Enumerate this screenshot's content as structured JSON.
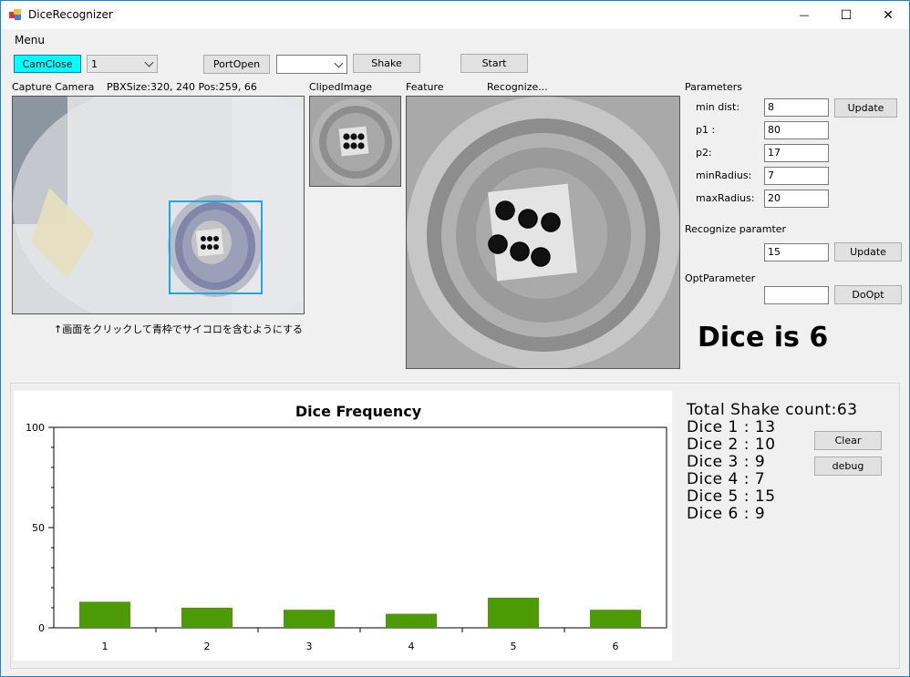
{
  "window": {
    "title": "DiceRecognizer",
    "minimize_glyph": "—",
    "maximize_glyph": "☐",
    "close_glyph": "✕"
  },
  "menu": {
    "label": "Menu"
  },
  "toolbar": {
    "camclose_label": "CamClose",
    "camera_select_value": "1",
    "portopen_label": "PortOpen",
    "port_select_value": "",
    "shake_label": "Shake",
    "start_label": "Start"
  },
  "capture": {
    "label": "Capture Camera",
    "info": "PBXSize:320, 240 Pos:259, 66",
    "hint": "↑画面をクリックして青枠でサイコロを含むようにする"
  },
  "clipped": {
    "label": "ClipedImage"
  },
  "feature": {
    "label": "Feature",
    "recognize_label": "Recognize..."
  },
  "parameters": {
    "header": "Parameters",
    "fields": [
      {
        "label": "min dist:",
        "value": "8"
      },
      {
        "label": "p1 :",
        "value": "80"
      },
      {
        "label": "p2:",
        "value": "17"
      },
      {
        "label": "minRadius:",
        "value": "7"
      },
      {
        "label": "maxRadius:",
        "value": "20"
      }
    ],
    "update_label": "Update"
  },
  "recognize_param": {
    "header": "Recognize paramter",
    "value": "15",
    "update_label": "Update"
  },
  "opt_param": {
    "header": "OptParameter",
    "value": "",
    "doopt_label": "DoOpt"
  },
  "result": {
    "text": "Dice is 6"
  },
  "stats": {
    "total": "Total Shake count:63",
    "lines": [
      "Dice 1 : 13",
      "Dice 2 : 10",
      "Dice 3 : 9",
      "Dice 4 : 7",
      "Dice 5 : 15",
      "Dice 6 : 9"
    ],
    "clear_label": "Clear",
    "debug_label": "debug"
  },
  "chart_data": {
    "type": "bar",
    "title": "Dice Frequency",
    "categories": [
      "1",
      "2",
      "3",
      "4",
      "5",
      "6"
    ],
    "values": [
      13,
      10,
      9,
      7,
      15,
      9
    ],
    "ylim": [
      0,
      100
    ],
    "yticks": [
      "0",
      "50",
      "100"
    ],
    "bar_color": "#4c9a06"
  },
  "colors": {
    "accent": "#00ffff",
    "selection_box": "#1ea7e1"
  }
}
